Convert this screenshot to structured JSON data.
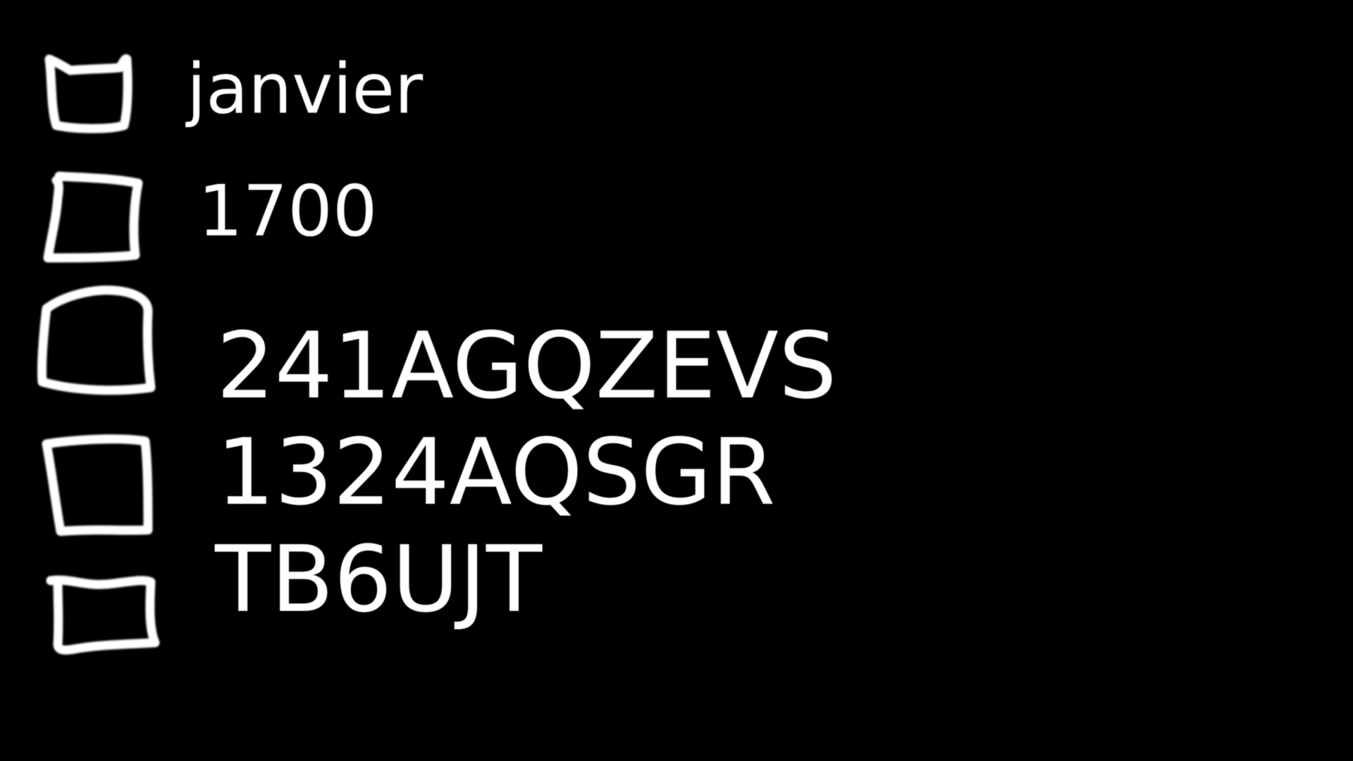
{
  "items": [
    {
      "label": "janvier",
      "checked": false,
      "icon": "hand-drawn-checkbox-icon"
    },
    {
      "label": "1700",
      "checked": false,
      "icon": "hand-drawn-checkbox-icon"
    },
    {
      "label": "241AGQZEVS",
      "checked": false,
      "icon": "hand-drawn-checkbox-icon"
    },
    {
      "label": "1324AQSGR",
      "checked": false,
      "icon": "hand-drawn-checkbox-icon"
    },
    {
      "label": "TB6UJT",
      "checked": false,
      "icon": "hand-drawn-checkbox-icon"
    }
  ],
  "colors": {
    "background": "#000000",
    "foreground": "#ffffff"
  }
}
